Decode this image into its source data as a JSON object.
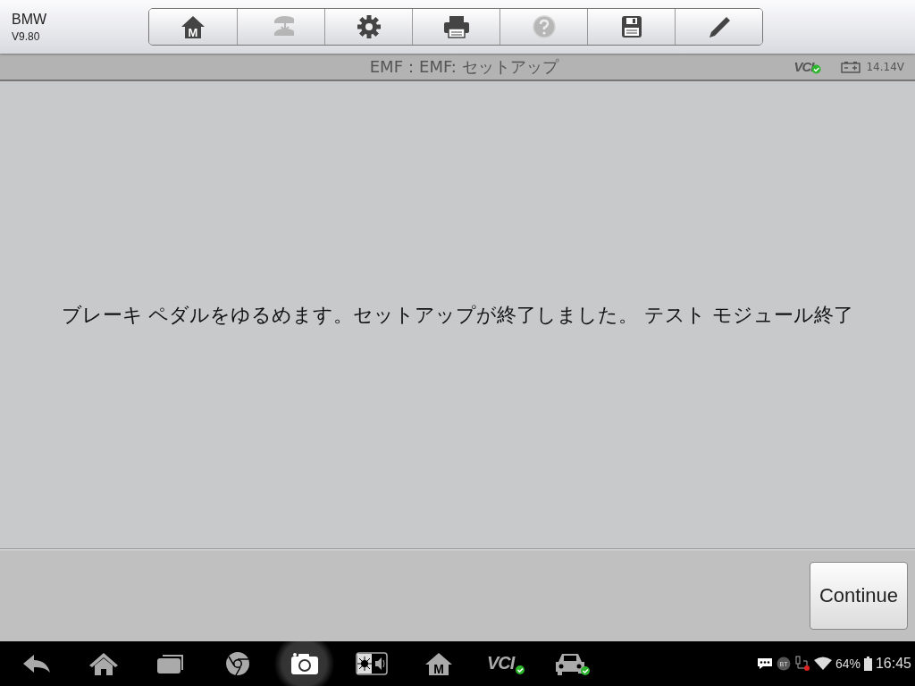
{
  "app": {
    "name": "BMW",
    "version": "V9.80"
  },
  "toolbar": [
    {
      "kind": "home",
      "letter": "M",
      "disabled": false
    },
    {
      "kind": "vehicle-transfer",
      "disabled": true
    },
    {
      "kind": "settings",
      "disabled": false
    },
    {
      "kind": "print",
      "disabled": false
    },
    {
      "kind": "help",
      "disabled": true
    },
    {
      "kind": "save",
      "disabled": false
    },
    {
      "kind": "edit",
      "disabled": false
    }
  ],
  "title_bar": {
    "title": "EMF：EMF: セットアップ",
    "vci_label": "VCI",
    "vci_connected": true,
    "voltage": "14.14V"
  },
  "message": "ブレーキ ペダルをゆるめます。セットアップが終了しました。 テスト モジュール終了",
  "buttons": [
    {
      "label": "Continue"
    }
  ],
  "taskbar": [
    {
      "kind": "back",
      "selected": false
    },
    {
      "kind": "home",
      "selected": false
    },
    {
      "kind": "recents",
      "selected": false
    },
    {
      "kind": "browser",
      "selected": false
    },
    {
      "kind": "camera",
      "selected": true
    },
    {
      "kind": "display-sound",
      "selected": false
    },
    {
      "kind": "home-m",
      "letter": "M",
      "selected": false
    },
    {
      "kind": "vci",
      "label": "VCI",
      "connected": true,
      "selected": false
    },
    {
      "kind": "car",
      "connected": true,
      "selected": false
    }
  ],
  "status_bar": {
    "bt": "BT",
    "battery": "64%",
    "time": "16:45"
  }
}
